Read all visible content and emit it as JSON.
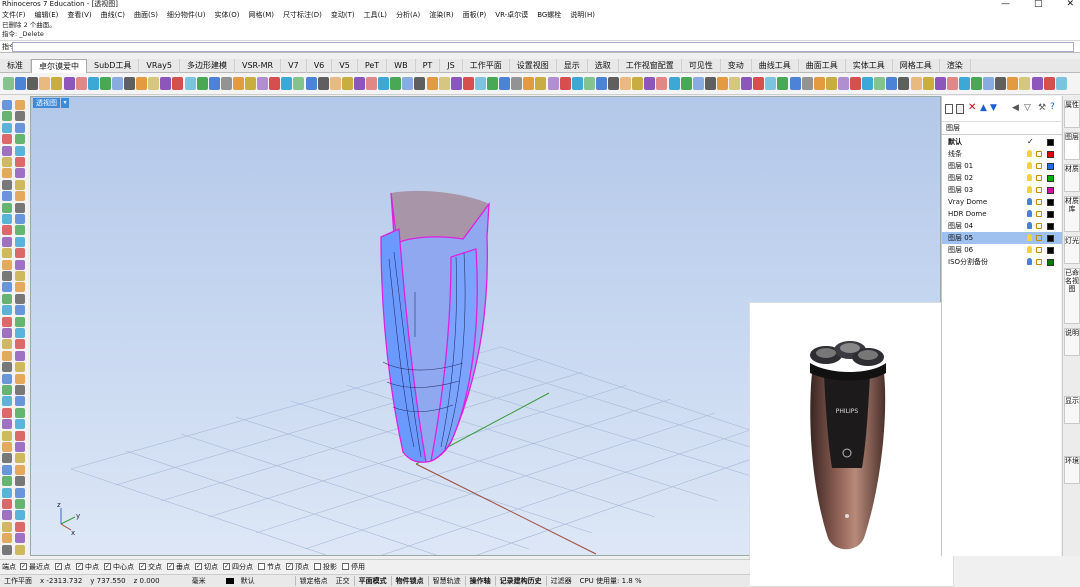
{
  "app": {
    "title": "Rhinoceros 7 Education - [透视图]"
  },
  "window_buttons": [
    "—",
    "□",
    "✕"
  ],
  "menu": [
    "文件(F)",
    "编辑(E)",
    "查看(V)",
    "曲线(C)",
    "曲面(S)",
    "细分物件(U)",
    "实体(O)",
    "网格(M)",
    "尺寸标注(D)",
    "变动(T)",
    "工具(L)",
    "分析(A)",
    "渲染(R)",
    "面板(P)",
    "VR-卓尔谟",
    "BG螺栓",
    "说明(H)"
  ],
  "command": {
    "history": [
      "已删除 2 个曲面。",
      "指令: _Delete"
    ],
    "prompt": "指令:",
    "value": ""
  },
  "tabs": [
    "标准",
    "卓尔谟爱中",
    "SubD工具",
    "VRay5",
    "多边形建模",
    "VSR-MR",
    "V7",
    "V6",
    "V5",
    "PeT",
    "WB",
    "PT",
    "JS",
    "工作平面",
    "设置视图",
    "显示",
    "选取",
    "工作视窗配置",
    "可见性",
    "变动",
    "曲线工具",
    "曲面工具",
    "实体工具",
    "网格工具",
    "渲染"
  ],
  "active_tab": "卓尔谟爱中",
  "viewport": {
    "label": "透视图",
    "axis": {
      "x": "x",
      "y": "y",
      "z": "z"
    }
  },
  "layers": {
    "header": "图层",
    "rows": [
      {
        "name": "默认",
        "current": true,
        "check": "✓",
        "color": "#000000"
      },
      {
        "name": "线条",
        "color": "#e00000"
      },
      {
        "name": "图层 01",
        "color": "#1f6fe0"
      },
      {
        "name": "图层 02",
        "color": "#00b000"
      },
      {
        "name": "图层 03",
        "color": "#d010a0"
      },
      {
        "name": "Vray Dome",
        "color": "#000000"
      },
      {
        "name": "HDR Dome",
        "color": "#000000"
      },
      {
        "name": "图层 04",
        "color": "#000000"
      },
      {
        "name": "图层 05",
        "color": "#000000",
        "selected": true
      },
      {
        "name": "图层 06",
        "color": "#000000"
      },
      {
        "name": "ISO分割备份",
        "color": "#007a00"
      }
    ]
  },
  "right_tabs": [
    "属性",
    "图层",
    "材质",
    "材质库",
    "灯光",
    "已命名视图",
    "说明",
    "显示",
    "环境"
  ],
  "osnap": {
    "lead": "端点",
    "items": [
      {
        "label": "最近点",
        "checked": true
      },
      {
        "label": "点",
        "checked": true
      },
      {
        "label": "中点",
        "checked": true
      },
      {
        "label": "中心点",
        "checked": true
      },
      {
        "label": "交点",
        "checked": true
      },
      {
        "label": "垂点",
        "checked": true
      },
      {
        "label": "切点",
        "checked": true
      },
      {
        "label": "四分点",
        "checked": true
      },
      {
        "label": "节点",
        "checked": false
      },
      {
        "label": "顶点",
        "checked": true
      },
      {
        "label": "投影",
        "checked": false
      },
      {
        "label": "停用",
        "checked": false
      }
    ]
  },
  "status": {
    "cplane": "工作平面",
    "x": "x -2313.732",
    "y": "y 737.550",
    "z": "z 0.000",
    "unit": "毫米",
    "layer": "默认",
    "toggles": [
      "锁定格点",
      "正交",
      "平面模式",
      "物件锁点",
      "智慧轨迹",
      "操作轴",
      "记录建构历史",
      "过滤器"
    ],
    "cpu": "CPU 使用量: 1.8 %"
  },
  "reference_image": {
    "brand": "PHILIPS"
  },
  "colors": {
    "accent": "#3c8ad8",
    "selection_magenta": "#e020e0",
    "surface_blue": "#6b9aff",
    "interior": "#a896a8"
  }
}
